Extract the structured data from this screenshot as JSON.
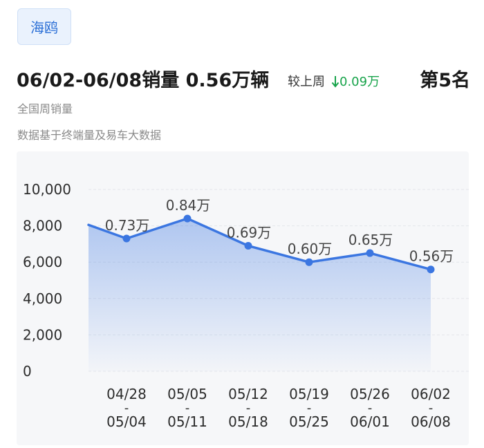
{
  "header": {
    "model_tag": "海鸥",
    "title": "06/02-06/08销量 0.56万辆",
    "compare_label": "较上周",
    "delta": "0.09万",
    "rank": "第5名",
    "subtitle": "全国周销量",
    "source": "数据基于终端量及易车大数据"
  },
  "colors": {
    "accent": "#3b76e1",
    "delta_down": "#17a34a",
    "tag_text": "#2b6fd6"
  },
  "chart_data": {
    "type": "area",
    "yticks": [
      "10,000",
      "8,000",
      "6,000",
      "4,000",
      "2,000",
      "0"
    ],
    "ylim": [
      0,
      10000
    ],
    "grid": true,
    "categories": [
      {
        "top": "04/28",
        "mid": "-",
        "bottom": "05/04"
      },
      {
        "top": "05/05",
        "mid": "-",
        "bottom": "05/11"
      },
      {
        "top": "05/12",
        "mid": "-",
        "bottom": "05/18"
      },
      {
        "top": "05/19",
        "mid": "-",
        "bottom": "05/25"
      },
      {
        "top": "05/26",
        "mid": "-",
        "bottom": "06/01"
      },
      {
        "top": "06/02",
        "mid": "-",
        "bottom": "06/08"
      }
    ],
    "leading_value": 8050,
    "values": [
      7300,
      8400,
      6900,
      6000,
      6500,
      5600
    ],
    "labels": [
      "0.73万",
      "0.84万",
      "0.69万",
      "0.60万",
      "0.65万",
      "0.56万"
    ]
  }
}
